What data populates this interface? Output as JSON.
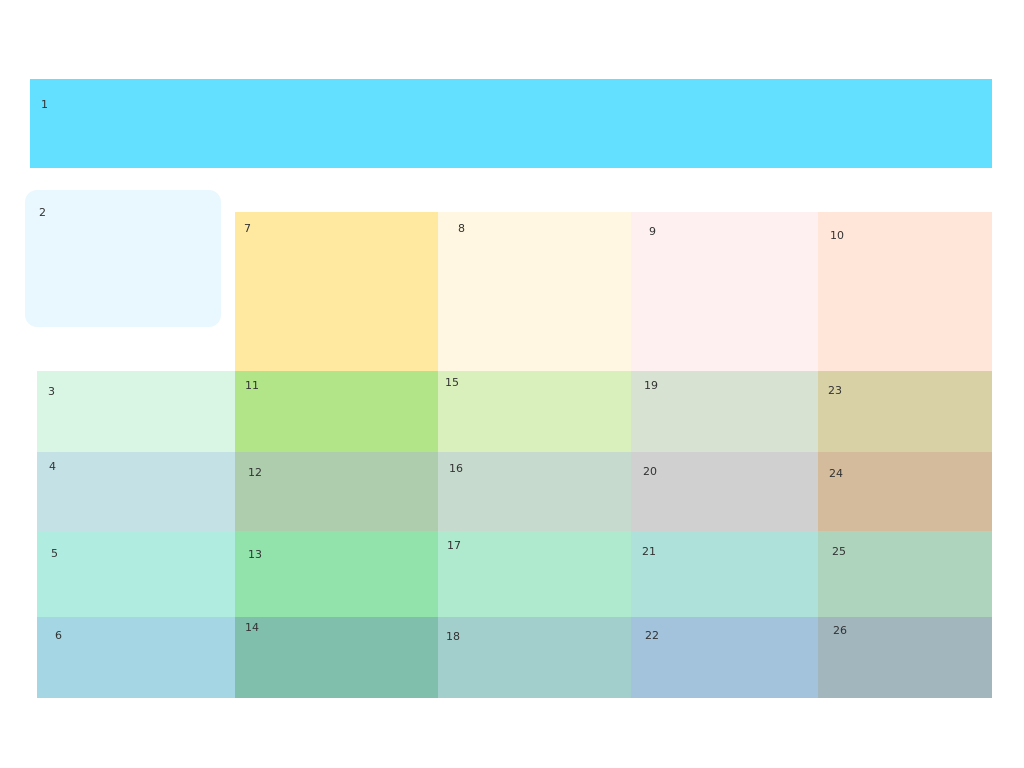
{
  "header": {
    "label": "1",
    "color": "#63dfff"
  },
  "sidebar_card": {
    "label": "2",
    "color": "#e9f8fe"
  },
  "row_labels": [
    {
      "label": "3",
      "color": "#d9f5e4"
    },
    {
      "label": "4",
      "color": "#c4e2e5"
    },
    {
      "label": "5",
      "color": "#b0ede0"
    },
    {
      "label": "6",
      "color": "#a4d7e3"
    }
  ],
  "top_cells": [
    {
      "label": "7",
      "color": "#ffe9a1"
    },
    {
      "label": "8",
      "color": "#fff7e1"
    },
    {
      "label": "9",
      "color": "#fef0f0"
    },
    {
      "label": "10",
      "color": "#ffe6d9"
    }
  ],
  "grid": [
    [
      {
        "label": "11",
        "color": "#b2e488"
      },
      {
        "label": "15",
        "color": "#d9f0bc"
      },
      {
        "label": "19",
        "color": "#d8e2d2"
      },
      {
        "label": "23",
        "color": "#d9d1a6"
      }
    ],
    [
      {
        "label": "12",
        "color": "#adcdad"
      },
      {
        "label": "16",
        "color": "#c7dace"
      },
      {
        "label": "20",
        "color": "#d0d0d0"
      },
      {
        "label": "24",
        "color": "#d3bb9c"
      }
    ],
    [
      {
        "label": "13",
        "color": "#91e2ab"
      },
      {
        "label": "17",
        "color": "#b0eace"
      },
      {
        "label": "21",
        "color": "#ade1da"
      },
      {
        "label": "25",
        "color": "#aed4be"
      }
    ],
    [
      {
        "label": "14",
        "color": "#81bfad"
      },
      {
        "label": "18",
        "color": "#a2cfcc"
      },
      {
        "label": "22",
        "color": "#a3c2dc"
      },
      {
        "label": "26",
        "color": "#a2b6bd"
      }
    ]
  ]
}
